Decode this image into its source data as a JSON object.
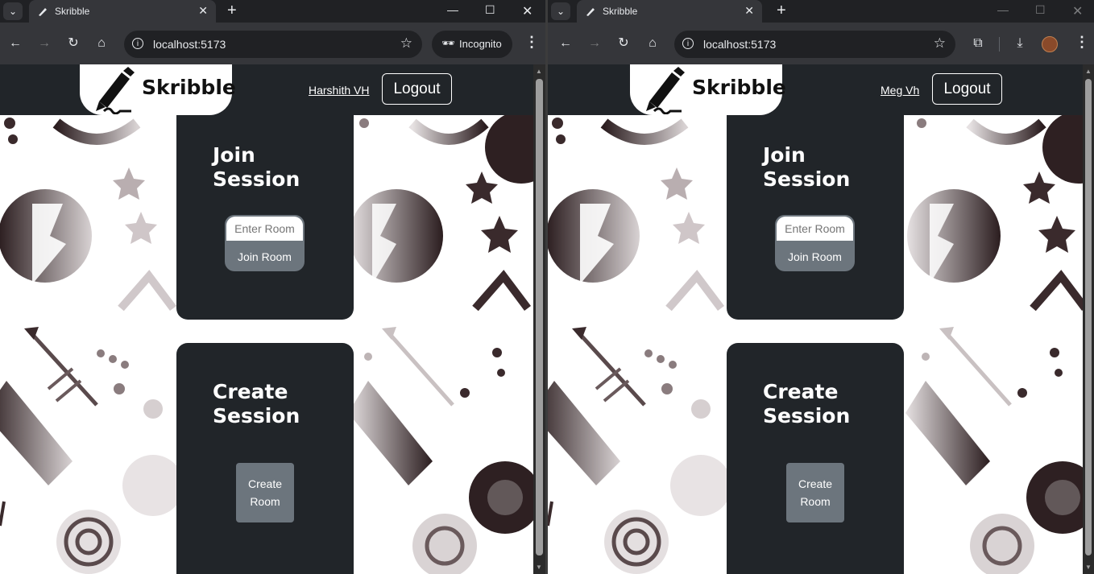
{
  "left_window": {
    "tab_title": "Skribble",
    "url": "localhost:5173",
    "incognito_label": "Incognito",
    "app": {
      "brand": "Skribble",
      "username": "Harshith VH",
      "logout_label": "Logout",
      "join": {
        "title_line1": "Join",
        "title_line2": "Session",
        "input_placeholder": "Enter Room",
        "button_label": "Join Room"
      },
      "create": {
        "title_line1": "Create",
        "title_line2": "Session",
        "button_line1": "Create",
        "button_line2": "Room"
      }
    }
  },
  "right_window": {
    "tab_title": "Skribble",
    "url": "localhost:5173",
    "app": {
      "brand": "Skribble",
      "username": "Meg Vh",
      "logout_label": "Logout",
      "join": {
        "title_line1": "Join",
        "title_line2": "Session",
        "input_placeholder": "Enter Room",
        "button_label": "Join Room"
      },
      "create": {
        "title_line1": "Create",
        "title_line2": "Session",
        "button_line1": "Create",
        "button_line2": "Room"
      }
    }
  },
  "colors": {
    "navbar": "#212529",
    "card": "#212529",
    "button": "#6c757d",
    "browser_chrome": "#35363a"
  },
  "icons": [
    "tab-menu-icon",
    "favicon-pen-icon",
    "close-tab-icon",
    "new-tab-icon",
    "minimize-icon",
    "maximize-icon",
    "close-window-icon",
    "back-icon",
    "forward-icon",
    "reload-icon",
    "home-icon",
    "site-info-icon",
    "bookmark-star-icon",
    "incognito-icon",
    "extensions-icon",
    "download-icon",
    "profile-avatar",
    "menu-kebab-icon",
    "pen-logo-icon",
    "doodle-background"
  ]
}
